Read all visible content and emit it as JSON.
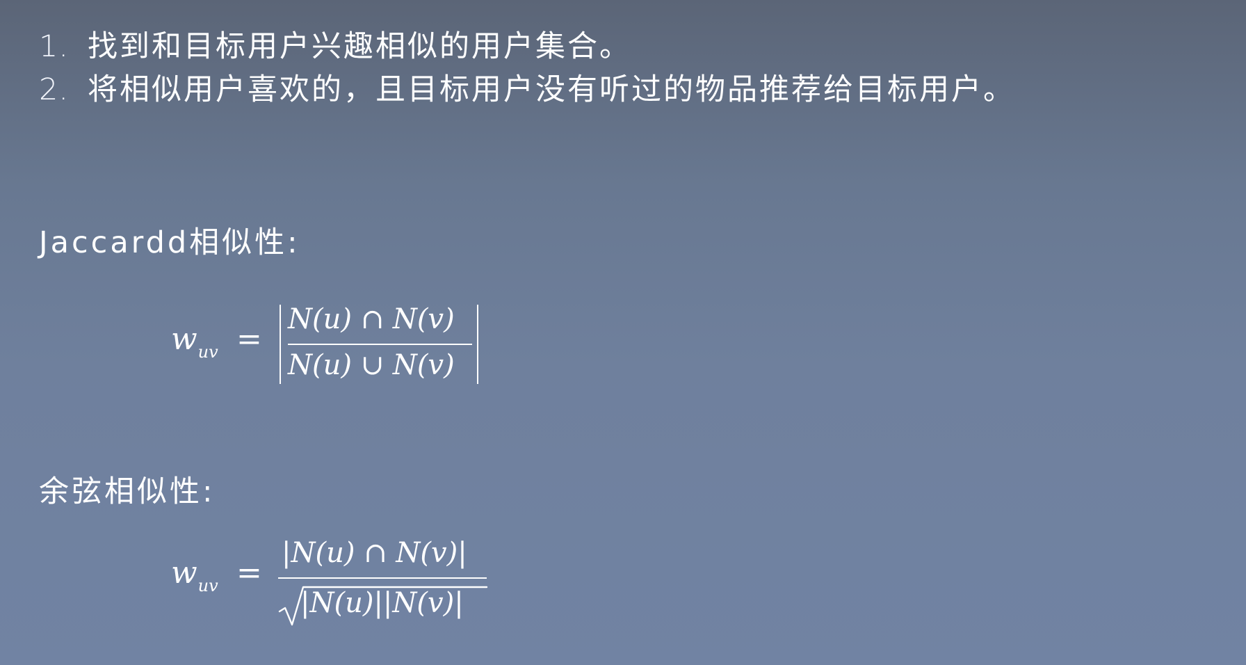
{
  "steps": [
    {
      "num": "1.",
      "text": "找到和目标用户兴趣相似的用户集合。"
    },
    {
      "num": "2.",
      "text": "将相似用户喜欢的，且目标用户没有听过的物品推荐给目标用户。"
    }
  ],
  "jaccard": {
    "heading": "Jaccardd相似性:",
    "lhs": "w",
    "lhs_sub": "uv",
    "equals": "=",
    "numerator": "N(u) ∩ N(v)",
    "denominator": "N(u) ∪ N(v)"
  },
  "cosine": {
    "heading": "余弦相似性:",
    "lhs": "w",
    "lhs_sub": "uv",
    "equals": "=",
    "numerator": "|N(u) ∩ N(v)|",
    "denominator": "|N(u)||N(v)|"
  }
}
